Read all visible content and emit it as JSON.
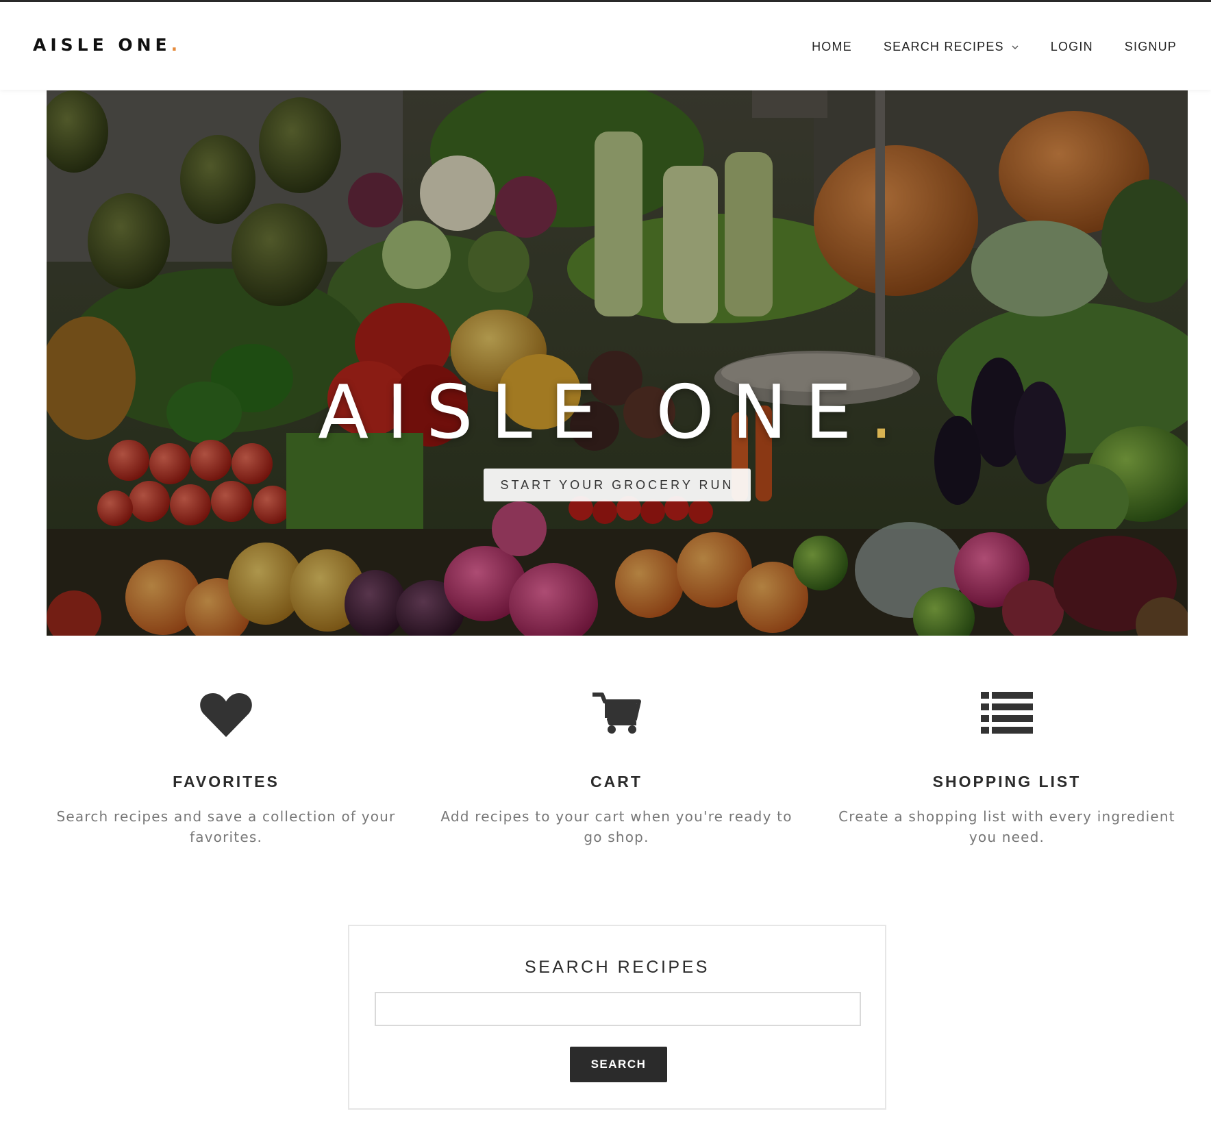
{
  "header": {
    "logo_text": "AISLE ONE",
    "logo_dot": ".",
    "nav": {
      "home": "HOME",
      "search_recipes": "SEARCH RECIPES",
      "login": "LOGIN",
      "signup": "SIGNUP"
    }
  },
  "hero": {
    "title": "AISLE ONE",
    "title_dot": ".",
    "cta_label": "START YOUR GROCERY RUN",
    "image_subject": "market produce stall with vegetables and fruits"
  },
  "features": [
    {
      "icon": "heart-icon",
      "title": "FAVORITES",
      "description": "Search recipes and save a collection of your favorites."
    },
    {
      "icon": "cart-icon",
      "title": "CART",
      "description": "Add recipes to your cart when you're ready to go shop."
    },
    {
      "icon": "list-icon",
      "title": "SHOPPING LIST",
      "description": "Create a shopping list with every ingredient you need."
    }
  ],
  "search": {
    "heading": "SEARCH RECIPES",
    "input_value": "",
    "input_placeholder": "",
    "button_label": "SEARCH"
  },
  "colors": {
    "accent_dot_logo": "#e58a3a",
    "accent_dot_hero": "#d8b352",
    "dark": "#2b2b2b",
    "muted_text": "#777777"
  }
}
